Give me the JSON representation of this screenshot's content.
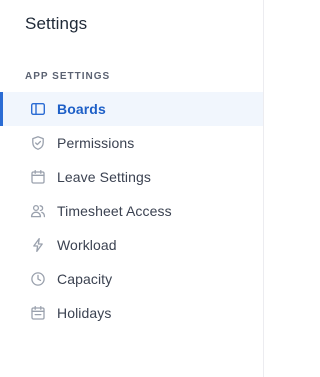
{
  "page": {
    "title": "Settings"
  },
  "section": {
    "label": "APP SETTINGS"
  },
  "menu": {
    "items": [
      {
        "label": "Boards",
        "icon": "sidebar-panel-icon",
        "active": true
      },
      {
        "label": "Permissions",
        "icon": "shield-check-icon",
        "active": false
      },
      {
        "label": "Leave Settings",
        "icon": "calendar-icon",
        "active": false
      },
      {
        "label": "Timesheet Access",
        "icon": "users-icon",
        "active": false
      },
      {
        "label": "Workload",
        "icon": "lightning-icon",
        "active": false
      },
      {
        "label": "Capacity",
        "icon": "clock-icon",
        "active": false
      },
      {
        "label": "Holidays",
        "icon": "calendar-event-icon",
        "active": false
      }
    ]
  },
  "colors": {
    "accent": "#2b6cd4",
    "active_background": "#f1f6fd",
    "icon_gray": "#9aa1ad",
    "text": "#3b4251"
  }
}
